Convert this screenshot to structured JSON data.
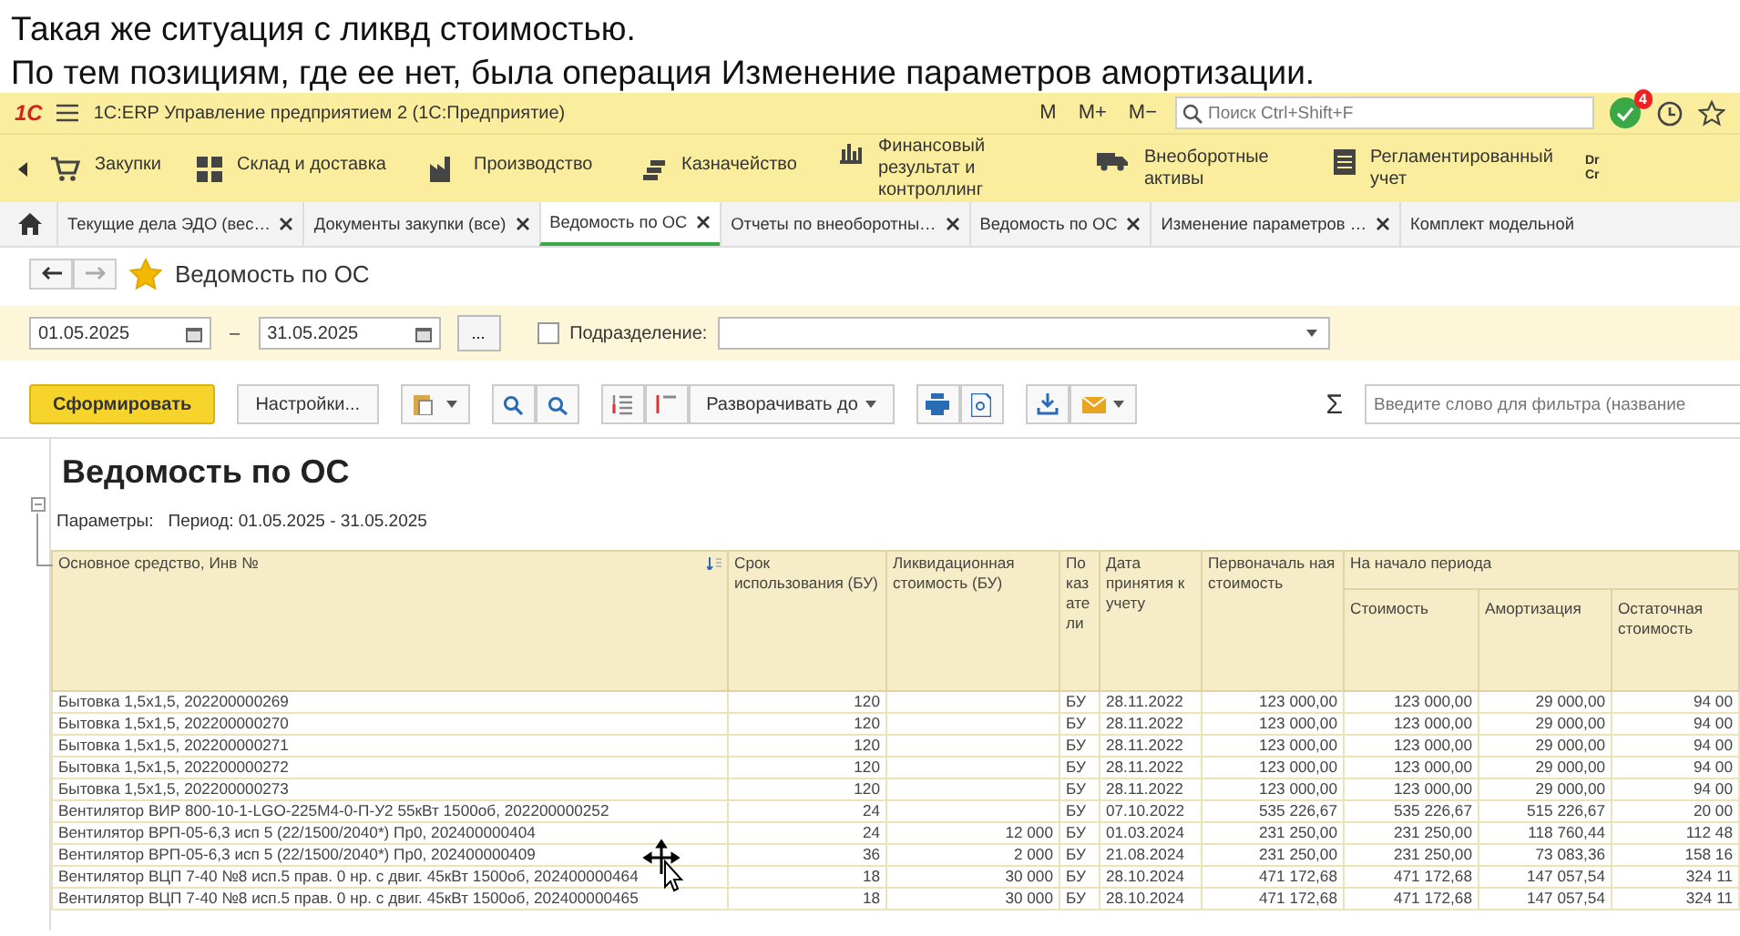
{
  "note": {
    "lines": [
      "Такая же ситуация с ликвд стоимостью.",
      "По тем позициям, где ее нет, была операция Изменение параметров амортизации."
    ]
  },
  "window": {
    "logo": "1С",
    "title": "1С:ERP Управление предприятием 2  (1С:Предприятие)",
    "memory_buttons": [
      "M",
      "M+",
      "M−"
    ],
    "search_placeholder": "Поиск Ctrl+Shift+F",
    "notification_count": "4"
  },
  "sections": [
    {
      "label": "Закупки"
    },
    {
      "label": "Склад и доставка"
    },
    {
      "label": "Производство"
    },
    {
      "label": "Казначейство"
    },
    {
      "label": "Финансовый результат и контроллинг"
    },
    {
      "label": "Внеоборотные активы"
    },
    {
      "label": "Регламентированный учет"
    }
  ],
  "ledger_label": "Dr Cr",
  "tabs": [
    {
      "label": "Текущие дела ЭДО (вес…",
      "selected": false,
      "closable": true
    },
    {
      "label": "Документы закупки (все)",
      "selected": false,
      "closable": true
    },
    {
      "label": "Ведомость по ОС",
      "selected": true,
      "closable": true
    },
    {
      "label": "Отчеты по внеоборотны…",
      "selected": false,
      "closable": true
    },
    {
      "label": "Ведомость по ОС",
      "selected": false,
      "closable": true
    },
    {
      "label": "Изменение параметров …",
      "selected": false,
      "closable": true
    },
    {
      "label": "Комплект модельной",
      "selected": false,
      "closable": false
    }
  ],
  "form": {
    "title": "Ведомость по ОС",
    "favorite": true
  },
  "period": {
    "from": "01.05.2025",
    "dash": "–",
    "to": "31.05.2025",
    "more_button": "...",
    "subdivision_checked": false,
    "subdivision_label": "Подразделение:"
  },
  "toolbar": {
    "generate": "Сформировать",
    "settings": "Настройки...",
    "expand": "Разворачивать до",
    "sum_sign": "Σ",
    "filter_placeholder": "Введите слово для фильтра (название"
  },
  "report": {
    "title": "Ведомость по ОС",
    "params_label": "Параметры:",
    "params_value": "Период: 01.05.2025 - 31.05.2025",
    "columns": [
      "Основное средство, Инв №",
      "Срок использования (БУ)",
      "Ликвидационная стоимость (БУ)",
      "По каз ате ли",
      "Дата принятия к учету",
      "Первоначаль ная стоимость"
    ],
    "group_header": "На начало периода",
    "group_columns": [
      "Стоимость",
      "Амортизация",
      "Остаточная стоимость"
    ],
    "rows": [
      [
        "Бытовка 1,5х1,5, 202200000269",
        "120",
        "",
        "БУ",
        "28.11.2022",
        "123 000,00",
        "123 000,00",
        "29 000,00",
        "94 00"
      ],
      [
        "Бытовка 1,5х1,5, 202200000270",
        "120",
        "",
        "БУ",
        "28.11.2022",
        "123 000,00",
        "123 000,00",
        "29 000,00",
        "94 00"
      ],
      [
        "Бытовка 1,5х1,5, 202200000271",
        "120",
        "",
        "БУ",
        "28.11.2022",
        "123 000,00",
        "123 000,00",
        "29 000,00",
        "94 00"
      ],
      [
        "Бытовка 1,5х1,5, 202200000272",
        "120",
        "",
        "БУ",
        "28.11.2022",
        "123 000,00",
        "123 000,00",
        "29 000,00",
        "94 00"
      ],
      [
        "Бытовка 1,5х1,5, 202200000273",
        "120",
        "",
        "БУ",
        "28.11.2022",
        "123 000,00",
        "123 000,00",
        "29 000,00",
        "94 00"
      ],
      [
        "Вентилятор ВИР 800-10-1-LGO-225M4-0-П-У2 55кВт 1500об, 202200000252",
        "24",
        "",
        "БУ",
        "07.10.2022",
        "535 226,67",
        "535 226,67",
        "515 226,67",
        "20 00"
      ],
      [
        "Вентилятор ВРП-05-6,3 исп 5 (22/1500/2040*) Пр0, 202400000404",
        "24",
        "12 000",
        "БУ",
        "01.03.2024",
        "231 250,00",
        "231 250,00",
        "118 760,44",
        "112 48"
      ],
      [
        "Вентилятор ВРП-05-6,3 исп 5 (22/1500/2040*) Пр0, 202400000409",
        "36",
        "2 000",
        "БУ",
        "21.08.2024",
        "231 250,00",
        "231 250,00",
        "73 083,36",
        "158 16"
      ],
      [
        "Вентилятор ВЦП 7-40 №8 исп.5 прав. 0 нр. с двиг. 45кВт 1500об, 202400000464",
        "18",
        "30 000",
        "БУ",
        "28.10.2024",
        "471 172,68",
        "471 172,68",
        "147 057,54",
        "324 11"
      ],
      [
        "Вентилятор ВЦП 7-40 №8 исп.5 прав. 0 нр. с двиг. 45кВт 1500об, 202400000465",
        "18",
        "30 000",
        "БУ",
        "28.10.2024",
        "471 172,68",
        "471 172,68",
        "147 057,54",
        "324 11"
      ]
    ]
  }
}
